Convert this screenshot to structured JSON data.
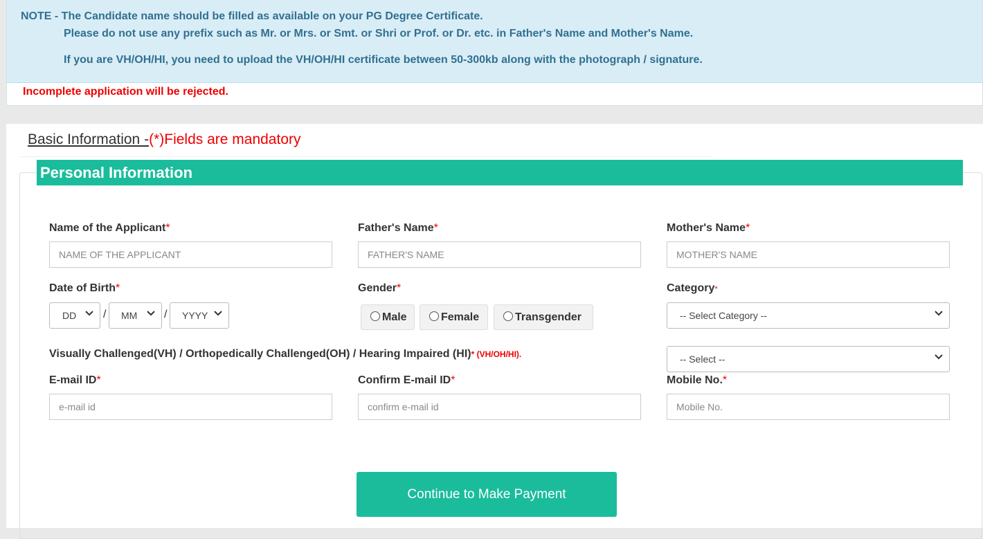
{
  "note": {
    "line1": "NOTE - The Candidate name should be filled as available on your PG Degree Certificate.",
    "line2": "Please do not use any prefix such as Mr. or Mrs. or Smt. or Shri or Prof. or Dr. etc. in Father's Name and Mother's Name.",
    "line3": "If you are VH/OH/HI, you need to upload the VH/OH/HI certificate between 50-300kb along with the photograph / signature.",
    "reject": "Incomplete application will be rejected."
  },
  "section": {
    "title": "Basic Information -",
    "mandatory": "(*)Fields are mandatory",
    "legend": "Personal Information"
  },
  "form": {
    "required_mark": "*",
    "applicant": {
      "label": "Name of the Applicant",
      "placeholder": "NAME OF THE APPLICANT"
    },
    "father": {
      "label": "Father's Name",
      "placeholder": "FATHER'S NAME"
    },
    "mother": {
      "label": "Mother's Name",
      "placeholder": "MOTHER'S NAME"
    },
    "dob": {
      "label": "Date of Birth",
      "day": "DD",
      "month": "MM",
      "year": "YYYY",
      "sep": "/"
    },
    "gender": {
      "label": "Gender",
      "options": [
        "Male",
        "Female",
        "Transgender"
      ]
    },
    "category": {
      "label": "Category",
      "selected": "-- Select Category --"
    },
    "disability": {
      "label": "Visually Challenged(VH) / Orthopedically Challenged(OH) / Hearing Impaired (HI)",
      "note": "* (VH/OH/HI).",
      "selected": "-- Select --"
    },
    "email": {
      "label": "E-mail ID",
      "placeholder": "e-mail id"
    },
    "confirm_email": {
      "label": "Confirm E-mail ID",
      "placeholder": "confirm e-mail id"
    },
    "mobile": {
      "label": "Mobile No.",
      "placeholder": "Mobile No."
    },
    "submit": "Continue to Make Payment"
  },
  "colors": {
    "accent": "#1abc9c",
    "note_bg": "#d9edf7",
    "note_text": "#31708f",
    "required": "#e00000"
  },
  "icons": {
    "select": "chevron-down-icon",
    "radio": "radio-unchecked-icon"
  }
}
